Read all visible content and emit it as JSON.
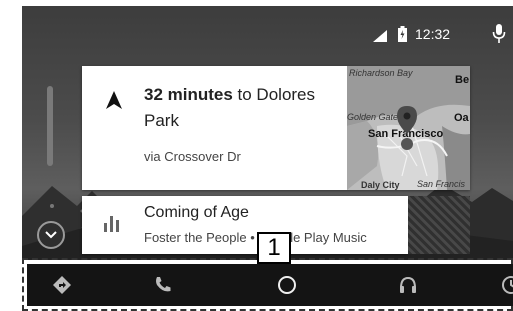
{
  "status_bar": {
    "time": "12:32",
    "signal_icon": "signal-icon",
    "battery_icon": "battery-icon",
    "mic_icon": "microphone-icon"
  },
  "nav_card": {
    "eta_bold": "32 minutes",
    "eta_rest": " to Dolores Park",
    "via": "via Crossover Dr",
    "map_labels": {
      "richardson_bay": "Richardson Bay",
      "golden_gate": "Golden Gate",
      "san_francisco": "San Francisco",
      "daly_city": "Daly City",
      "san_francis_partial": "San Francis",
      "oa": "Oa",
      "be": "Be"
    }
  },
  "media_card": {
    "title": "Coming of Age",
    "subtitle": "Foster the People • Google Play Music",
    "icon": "equalizer-icon"
  },
  "callout": {
    "label": "1"
  },
  "nav_bar": {
    "items": [
      {
        "name": "navigation-button",
        "icon": "directions-icon"
      },
      {
        "name": "phone-button",
        "icon": "phone-icon"
      },
      {
        "name": "home-button",
        "icon": "home-circle-icon"
      },
      {
        "name": "audio-button",
        "icon": "headphones-icon"
      },
      {
        "name": "exit-button",
        "icon": "exit-icon"
      }
    ]
  }
}
